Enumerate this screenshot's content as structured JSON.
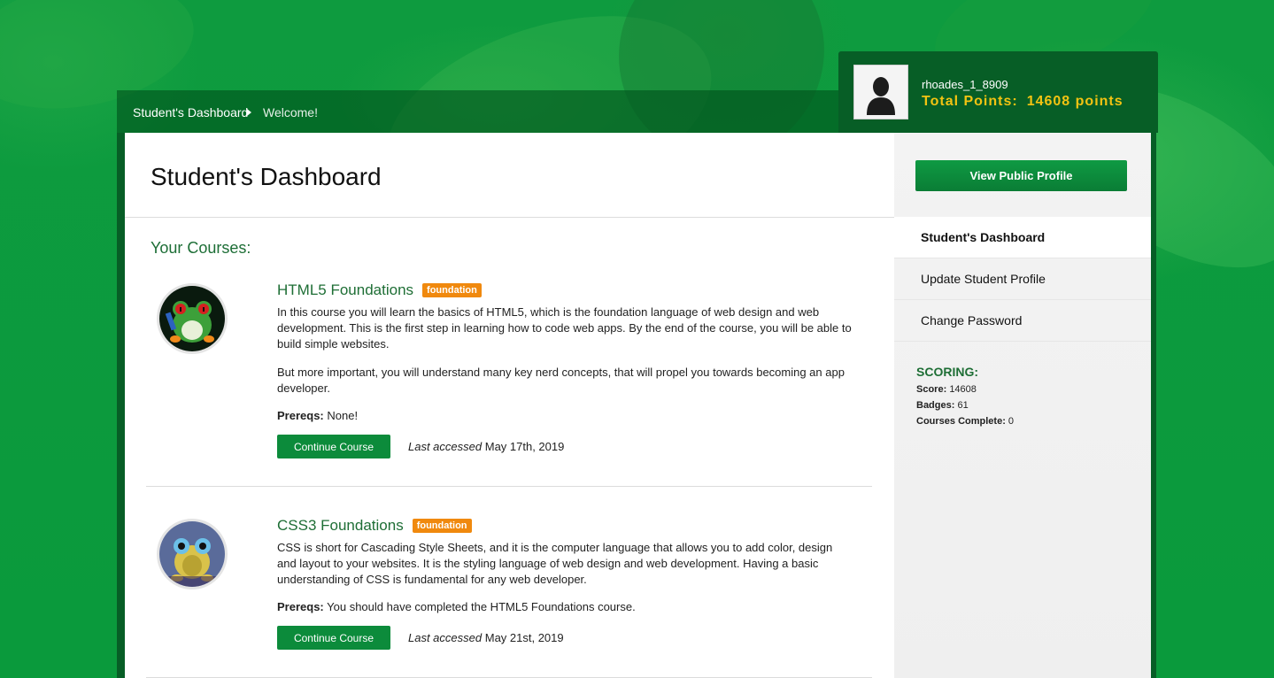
{
  "breadcrumb": {
    "root": "Student's Dashboard",
    "current": "Welcome!"
  },
  "profile": {
    "username": "rhoades_1_8909",
    "points_label": "Total Points:",
    "points_value": "14608 points"
  },
  "main": {
    "title": "Student's Dashboard",
    "section_title": "Your Courses:",
    "courses": [
      {
        "title": "HTML5 Foundations",
        "badge": "foundation",
        "description": "In this course you will learn the basics of HTML5, which is the foundation language of web design and web development. This is the first step in learning how to code web apps. By the end of the course, you will be able to build simple websites.",
        "description2": "But more important, you will understand many key nerd concepts, that will propel you towards becoming an app developer.",
        "prereq_label": "Prereqs:",
        "prereq": "None!",
        "button": "Continue Course",
        "accessed_label": "Last accessed",
        "accessed_date": "May 17th, 2019"
      },
      {
        "title": "CSS3 Foundations",
        "badge": "foundation",
        "description": "CSS is short for Cascading Style Sheets, and it is the computer language that allows you to add color, design and layout to your websites. It is the styling language of web design and web development. Having a basic understanding of CSS is fundamental for any web developer.",
        "prereq_label": "Prereqs:",
        "prereq": "You should have completed the HTML5 Foundations course.",
        "button": "Continue Course",
        "accessed_label": "Last accessed",
        "accessed_date": "May 21st, 2019"
      }
    ]
  },
  "sidebar": {
    "view_profile_button": "View Public Profile",
    "nav": [
      {
        "label": "Student's Dashboard",
        "active": true
      },
      {
        "label": "Update Student Profile",
        "active": false
      },
      {
        "label": "Change Password",
        "active": false
      }
    ],
    "scoring": {
      "title": "SCORING:",
      "score_label": "Score:",
      "score": "14608",
      "badges_label": "Badges:",
      "badges": "61",
      "complete_label": "Courses Complete:",
      "complete": "0"
    }
  },
  "colors": {
    "brand_green": "#0c8b3b",
    "dark_green": "#075e26",
    "points_gold": "#f2c312",
    "badge_orange": "#f0890e"
  }
}
